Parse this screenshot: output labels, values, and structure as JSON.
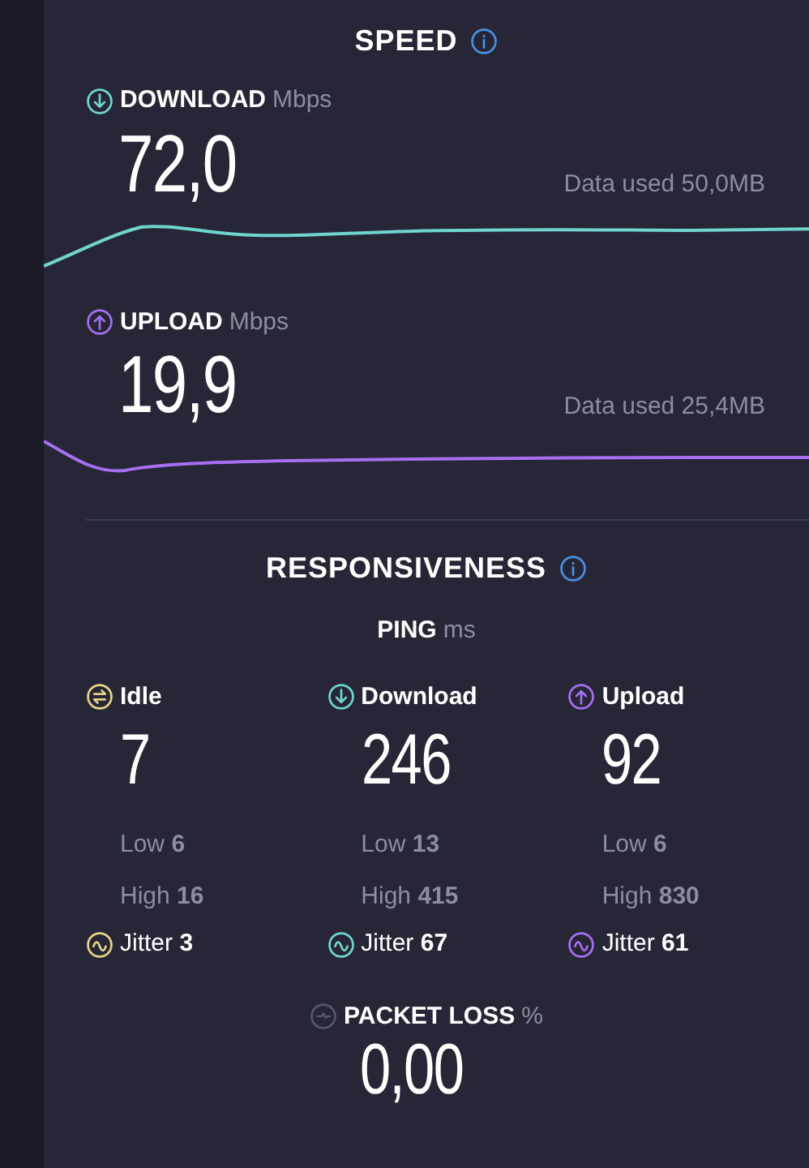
{
  "speed": {
    "title": "SPEED",
    "tests": [
      {
        "kind": "download",
        "label": "DOWNLOAD",
        "unit": "Mbps",
        "value": "72,0",
        "data_used": "Data used 50,0MB"
      },
      {
        "kind": "upload",
        "label": "UPLOAD",
        "unit": "Mbps",
        "value": "19,9",
        "data_used": "Data used 25,4MB"
      }
    ]
  },
  "responsiveness": {
    "title": "RESPONSIVENESS",
    "ping_label": "PING",
    "ping_unit": "ms",
    "columns": [
      {
        "kind": "idle",
        "label": "Idle",
        "value": "7",
        "low_label": "Low",
        "low": "6",
        "high_label": "High",
        "high": "16",
        "jitter_label": "Jitter",
        "jitter": "3"
      },
      {
        "kind": "download",
        "label": "Download",
        "value": "246",
        "low_label": "Low",
        "low": "13",
        "high_label": "High",
        "high": "415",
        "jitter_label": "Jitter",
        "jitter": "67"
      },
      {
        "kind": "upload",
        "label": "Upload",
        "value": "92",
        "low_label": "Low",
        "low": "6",
        "high_label": "High",
        "high": "830",
        "jitter_label": "Jitter",
        "jitter": "61"
      }
    ]
  },
  "packet_loss": {
    "label": "PACKET LOSS",
    "unit": "%",
    "value": "0,00"
  }
}
